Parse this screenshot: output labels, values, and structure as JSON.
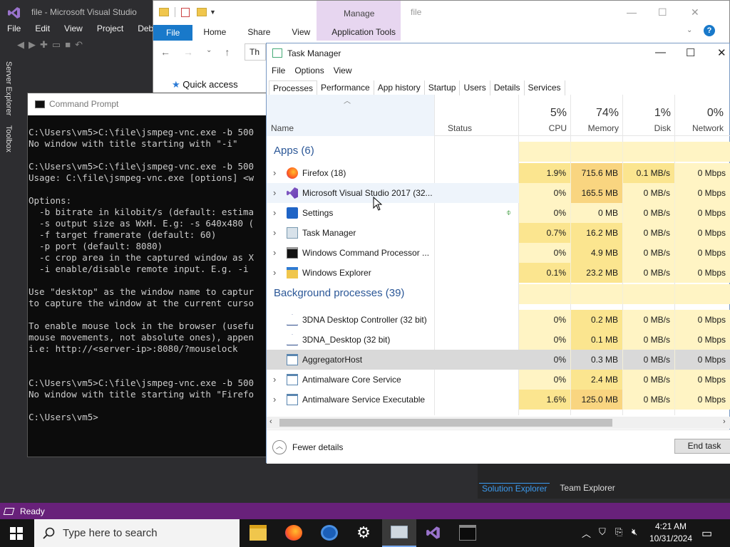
{
  "vs": {
    "title": "file - Microsoft Visual Studio",
    "menu": [
      "File",
      "Edit",
      "View",
      "Project",
      "Debu"
    ],
    "side_tabs": [
      "Server Explorer",
      "Toolbox"
    ],
    "bottom_tabs": [
      "Solution Explorer",
      "Team Explorer"
    ],
    "status": "Ready",
    "accent": "#68217a"
  },
  "explorer": {
    "manage_tab": "Manage",
    "title": "file",
    "ribbon_tabs": [
      "File",
      "Home",
      "Share",
      "View",
      "Application Tools"
    ],
    "address_fragment": "Th",
    "quick_access": "Quick access"
  },
  "cmd": {
    "title": "Command Prompt",
    "lines": [
      "C:\\Users\\vm5>C:\\file\\jsmpeg-vnc.exe -b 500",
      "No window with title starting with \"-i\"",
      "",
      "C:\\Users\\vm5>C:\\file\\jsmpeg-vnc.exe -b 500",
      "Usage: C:\\file\\jsmpeg-vnc.exe [options] <w",
      "",
      "Options:",
      "  -b bitrate in kilobit/s (default: estima",
      "  -s output size as WxH. E.g: -s 640x480 (",
      "  -f target framerate (default: 60)",
      "  -p port (default: 8080)",
      "  -c crop area in the captured window as X",
      "  -i enable/disable remote input. E.g. -i ",
      "",
      "Use \"desktop\" as the window name to captur",
      "to capture the window at the current curso",
      "",
      "To enable mouse lock in the browser (usefu",
      "mouse movements, not absolute ones), appen",
      "i.e: http://<server-ip>:8080/?mouselock",
      "",
      "",
      "C:\\Users\\vm5>C:\\file\\jsmpeg-vnc.exe -b 500",
      "No window with title starting with \"Firefo",
      "",
      "C:\\Users\\vm5>"
    ]
  },
  "tm": {
    "title": "Task Manager",
    "menu": [
      "File",
      "Options",
      "View"
    ],
    "tabs": [
      "Processes",
      "Performance",
      "App history",
      "Startup",
      "Users",
      "Details",
      "Services"
    ],
    "headers": {
      "name": "Name",
      "status": "Status",
      "cpu_pct": "5%",
      "cpu": "CPU",
      "mem_pct": "74%",
      "mem": "Memory",
      "disk_pct": "1%",
      "disk": "Disk",
      "net_pct": "0%",
      "net": "Network"
    },
    "apps_group": "Apps (6)",
    "bg_group": "Background processes (39)",
    "apps": [
      {
        "name": "Firefox (18)",
        "icon": "firefox-icon",
        "cpu": "1.9%",
        "mem": "715.6 MB",
        "disk": "0.1 MB/s",
        "net": "0 Mbps",
        "expandable": true
      },
      {
        "name": "Microsoft Visual Studio 2017 (32...",
        "icon": "visual-studio-icon",
        "cpu": "0%",
        "mem": "165.5 MB",
        "disk": "0 MB/s",
        "net": "0 Mbps",
        "expandable": true
      },
      {
        "name": "Settings",
        "icon": "settings-gear-icon",
        "cpu": "0%",
        "mem": "0 MB",
        "disk": "0 MB/s",
        "net": "0 Mbps",
        "expandable": true,
        "status_icon": "suspended-leaf-icon"
      },
      {
        "name": "Task Manager",
        "icon": "task-manager-icon",
        "cpu": "0.7%",
        "mem": "16.2 MB",
        "disk": "0 MB/s",
        "net": "0 Mbps",
        "expandable": true
      },
      {
        "name": "Windows Command Processor ...",
        "icon": "cmd-icon",
        "cpu": "0%",
        "mem": "4.9 MB",
        "disk": "0 MB/s",
        "net": "0 Mbps",
        "expandable": true
      },
      {
        "name": "Windows Explorer",
        "icon": "folder-icon",
        "cpu": "0.1%",
        "mem": "23.2 MB",
        "disk": "0 MB/s",
        "net": "0 Mbps",
        "expandable": true
      }
    ],
    "background": [
      {
        "name": "3DNA Desktop Controller (32 bit)",
        "icon": "3dna-icon",
        "cpu": "0%",
        "mem": "0.2 MB",
        "disk": "0 MB/s",
        "net": "0 Mbps",
        "expandable": false
      },
      {
        "name": "3DNA_Desktop (32 bit)",
        "icon": "3dna-icon",
        "cpu": "0%",
        "mem": "0.1 MB",
        "disk": "0 MB/s",
        "net": "0 Mbps",
        "expandable": false
      },
      {
        "name": "AggregatorHost",
        "icon": "app-window-icon",
        "cpu": "0%",
        "mem": "0.3 MB",
        "disk": "0 MB/s",
        "net": "0 Mbps",
        "expandable": false,
        "selected": true
      },
      {
        "name": "Antimalware Core Service",
        "icon": "app-window-icon",
        "cpu": "0%",
        "mem": "2.4 MB",
        "disk": "0 MB/s",
        "net": "0 Mbps",
        "expandable": true
      },
      {
        "name": "Antimalware Service Executable",
        "icon": "app-window-icon",
        "cpu": "1.6%",
        "mem": "125.0 MB",
        "disk": "0 MB/s",
        "net": "0 Mbps",
        "expandable": true
      }
    ],
    "fewer_details": "Fewer details",
    "end_task": "End task"
  },
  "taskbar": {
    "search_placeholder": "Type here to search",
    "time": "4:21 AM",
    "date": "10/31/2024"
  },
  "colors": {
    "cpu_heat_high": "#fbe58f",
    "heat_low": "#fff4c4",
    "mem_heat_high": "#f9d580",
    "tm_group": "#2b5797",
    "explorer_file_tab": "#1979ca"
  }
}
